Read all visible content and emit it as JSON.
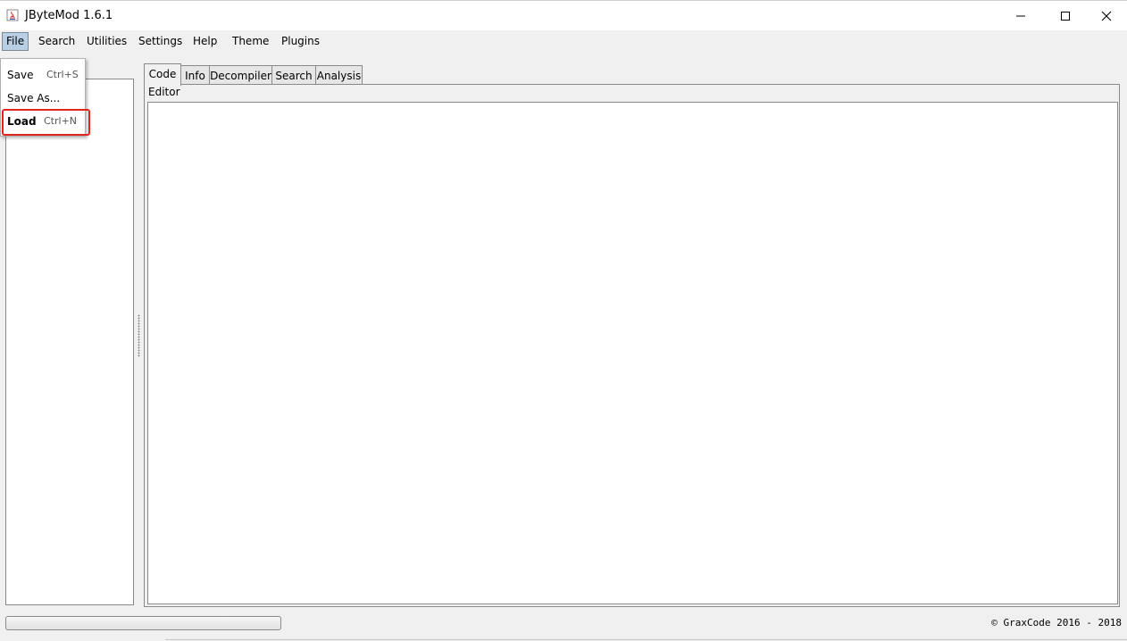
{
  "window": {
    "title": "JByteMod 1.6.1",
    "controls": [
      "minimize-icon",
      "maximize-icon",
      "close-icon"
    ]
  },
  "menubar": {
    "items": [
      {
        "label": "File",
        "active": true
      },
      {
        "label": "Search"
      },
      {
        "label": "Utilities"
      },
      {
        "label": "Settings"
      },
      {
        "label": "Help"
      },
      {
        "label": "Theme"
      },
      {
        "label": "Plugins"
      }
    ]
  },
  "file_menu": {
    "items": [
      {
        "label": "Save",
        "shortcut": "Ctrl+S"
      },
      {
        "label": "Save As...",
        "shortcut": ""
      },
      {
        "label": "Load",
        "shortcut": "Ctrl+N",
        "highlighted": true
      }
    ],
    "highlight_color": "#e0251d"
  },
  "tabs": [
    {
      "label": "Code",
      "selected": true
    },
    {
      "label": "Info"
    },
    {
      "label": "Decompiler"
    },
    {
      "label": "Search"
    },
    {
      "label": "Analysis"
    }
  ],
  "editor": {
    "label": "Editor",
    "content": ""
  },
  "status": {
    "copyright": "© GraxCode 2016 - 2018"
  }
}
